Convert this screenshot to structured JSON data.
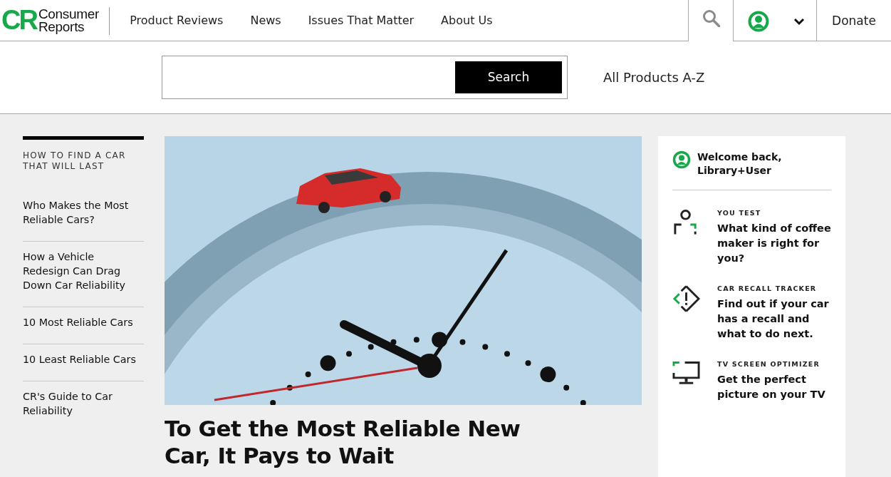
{
  "header": {
    "logo": {
      "mark": "CR",
      "line1": "Consumer",
      "line2": "Reports"
    },
    "nav": [
      {
        "label": "Product Reviews"
      },
      {
        "label": "News"
      },
      {
        "label": "Issues That Matter"
      },
      {
        "label": "About Us"
      }
    ],
    "search_toggle": {
      "selected": true
    },
    "donate": "Donate"
  },
  "search_panel": {
    "button": "Search",
    "link": "All Products A-Z"
  },
  "sidebar": {
    "title": "HOW TO FIND A CAR THAT WILL LAST",
    "links": [
      {
        "label": "Who Makes the Most Reliable Cars?"
      },
      {
        "label": "How a Vehicle Redesign Can Drag Down Car Reliability"
      },
      {
        "label": "10 Most Reliable Cars"
      },
      {
        "label": "10 Least Reliable Cars"
      },
      {
        "label": "CR's Guide to Car Reliability"
      }
    ]
  },
  "article": {
    "headline": "To Get the Most Reliable New Car, It Pays to Wait"
  },
  "account_card": {
    "welcome": "Welcome back, Library+User",
    "tools": [
      {
        "kind": "test",
        "eyebrow": "YOU TEST",
        "title": "What kind of coffee maker is right for you?"
      },
      {
        "kind": "recall",
        "eyebrow": "CAR RECALL TRACKER",
        "title": "Find out if your car has a recall and what to do next."
      },
      {
        "kind": "tv",
        "eyebrow": "TV SCREEN OPTIMIZER",
        "title": "Get the perfect picture on your TV"
      }
    ]
  }
}
